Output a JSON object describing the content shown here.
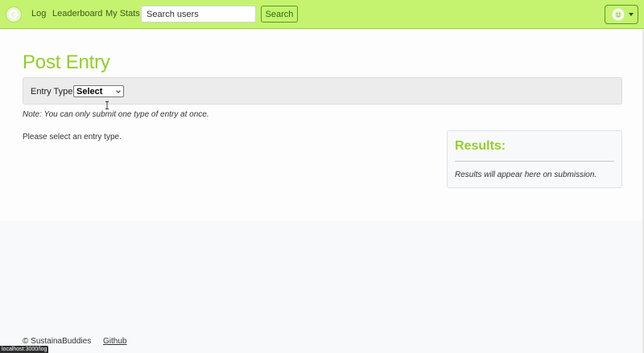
{
  "navbar": {
    "links": [
      "Log",
      "Leaderboard",
      "My Stats"
    ],
    "search_placeholder": "Search users",
    "search_button": "Search",
    "brand_icon": "g-logo-icon",
    "accent_color": "#c5f36f"
  },
  "page": {
    "title": "Post Entry",
    "entry_type_label": "Entry Type:",
    "entry_type_selected": "Select",
    "note": "Note: You can only submit one type of entry at once.",
    "select_message": "Please select an entry type."
  },
  "results": {
    "title": "Results:",
    "text": "Results will appear here on submission."
  },
  "footer": {
    "copyright": "© SustainaBuddies",
    "github": "Github"
  },
  "status_bar": {
    "url": "localhost:3000/log"
  },
  "colors": {
    "title_green": "#93cf27",
    "page_background": "#f8f9fa"
  }
}
